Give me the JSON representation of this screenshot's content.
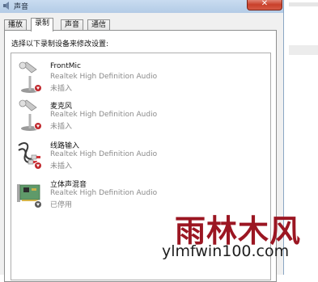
{
  "window": {
    "title": "声音",
    "close_symbol": "✕"
  },
  "tabs": [
    {
      "label": "播放"
    },
    {
      "label": "录制"
    },
    {
      "label": "声音"
    },
    {
      "label": "通信"
    }
  ],
  "active_tab": "录制",
  "instruction": "选择以下录制设备来修改设置:",
  "devices": [
    {
      "name": "FrontMic",
      "description": "Realtek High Definition Audio",
      "state": "未插入",
      "icon": "microphone-icon",
      "status_icon": "red-down-arrow-icon"
    },
    {
      "name": "麦克风",
      "description": "Realtek High Definition Audio",
      "state": "未插入",
      "icon": "microphone-icon",
      "status_icon": "red-down-arrow-icon"
    },
    {
      "name": "线路输入",
      "description": "Realtek High Definition Audio",
      "state": "未插入",
      "icon": "line-in-cable-icon",
      "status_icon": "red-down-arrow-icon"
    },
    {
      "name": "立体声混音",
      "description": "Realtek High Definition Audio",
      "state": "已停用",
      "icon": "sound-card-icon",
      "status_icon": "gray-down-arrow-icon"
    }
  ],
  "watermark": {
    "brand": "雨林木风",
    "url": "ylmfwin100.com"
  },
  "colors": {
    "title_bar": "#bcd3ea",
    "close_button": "#c9402b",
    "dialog_bg": "#f0f0f0",
    "secondary_text": "#8a8a8a",
    "watermark_red": "#9b1622"
  }
}
